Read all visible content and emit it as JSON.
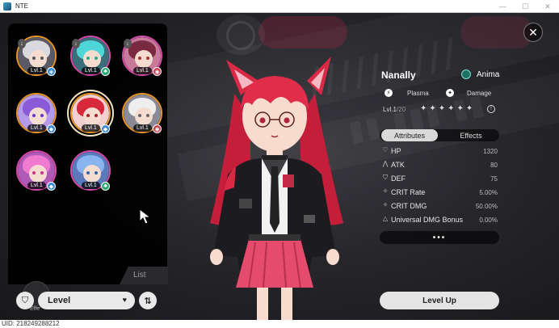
{
  "window": {
    "title": "NTE",
    "minimize": "—",
    "maximize": "☐",
    "close": "✕"
  },
  "character_list": {
    "list_label": "List",
    "avatars": [
      {
        "level": "Lvl.1",
        "element": "◈",
        "badge": "↓",
        "theme": "silver",
        "selected": false
      },
      {
        "level": "Lvl.1",
        "element": "♣",
        "badge": "↓",
        "theme": "teal",
        "selected": false
      },
      {
        "level": "Lvl.1",
        "element": "◉",
        "badge": "↓",
        "theme": "maroon",
        "selected": false
      },
      {
        "level": "Lvl.1",
        "element": "◆",
        "badge": "",
        "theme": "purple",
        "selected": false
      },
      {
        "level": "Lvl.1",
        "element": "◆",
        "badge": "",
        "theme": "red",
        "selected": true
      },
      {
        "level": "Lvl.1",
        "element": "◉",
        "badge": "",
        "theme": "white",
        "selected": false
      },
      {
        "level": "Lvl.1",
        "element": "◆",
        "badge": "",
        "theme": "pink",
        "selected": false
      },
      {
        "level": "Lvl.1",
        "element": "♣",
        "badge": "",
        "theme": "blue",
        "selected": false
      }
    ]
  },
  "controls": {
    "filter_icon": "⛉",
    "sort_value": "Level",
    "sort_caret": "♥",
    "order_icon": "⇅",
    "small_label": "Effe"
  },
  "uid": "UID: 218249288212",
  "close_icon": "✕",
  "character": {
    "name": "Nanally",
    "faction": "Anima",
    "tags": [
      {
        "label": "Plasma",
        "icon": "⚡"
      },
      {
        "label": "Damage",
        "icon": "✦"
      }
    ],
    "level_prefix": "Lvl.",
    "level": "1",
    "level_cap": "/20",
    "stars": "✦✦✦✦✦✦",
    "star_info_icon": "!"
  },
  "tabs": {
    "attributes": "Attributes",
    "effects": "Effects"
  },
  "attributes": [
    {
      "icon": "♡",
      "label": "HP",
      "value": "1320"
    },
    {
      "icon": "⋀",
      "label": "ATK",
      "value": "80"
    },
    {
      "icon": "⛉",
      "label": "DEF",
      "value": "75"
    },
    {
      "icon": "✧",
      "label": "CRIT Rate",
      "value": "5.00%"
    },
    {
      "icon": "✧",
      "label": "CRIT DMG",
      "value": "50.00%"
    },
    {
      "icon": "△",
      "label": "Universal DMG Bonus",
      "value": "0.00%"
    }
  ],
  "more_label": "•••",
  "level_up_label": "Level Up",
  "colors": {
    "accent_red": "#e8294e",
    "panel_black": "#000000",
    "button_light": "#e4e4e4",
    "anima_teal": "#1f6f66"
  }
}
